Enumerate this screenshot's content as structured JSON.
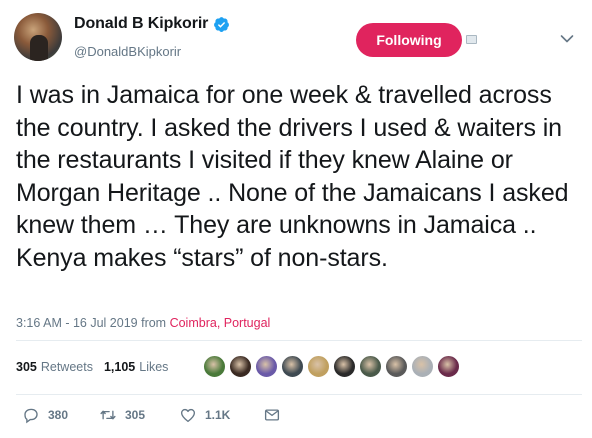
{
  "user": {
    "display_name": "Donald B Kipkorir",
    "handle": "@DonaldBKipkorir"
  },
  "follow_button": {
    "label": "Following",
    "color": "#e0245e"
  },
  "tweet": {
    "text": "I was in Jamaica for one week & travelled across the country. I asked the drivers I used & waiters in the restaurants I visited if they knew Alaine or Morgan Heritage .. None of the Jamaicans I asked knew them … They are unknowns in Jamaica .. Kenya makes “stars” of non-stars.",
    "timestamp": "3:16 AM - 16 Jul 2019",
    "from_label": "from",
    "location": "Coimbra, Portugal"
  },
  "stats": {
    "retweets_count": "305",
    "retweets_label": "Retweets",
    "likes_count": "1,105",
    "likes_label": "Likes"
  },
  "likers": [
    {
      "color": "#4a7a3a"
    },
    {
      "color": "#3a2a22"
    },
    {
      "color": "#6a5aa8"
    },
    {
      "color": "#3f4a52"
    },
    {
      "color": "#c0a060"
    },
    {
      "color": "#2a2a2a"
    },
    {
      "color": "#4a5a4a"
    },
    {
      "color": "#5a5a5a"
    },
    {
      "color": "#aab0b6"
    },
    {
      "color": "#6a2a4a"
    }
  ],
  "actions": {
    "reply_count": "380",
    "retweet_count": "305",
    "like_count": "1.1K"
  },
  "icons": {
    "verified": "verified-badge-icon",
    "caret": "chevron-down-icon",
    "reply": "reply-icon",
    "retweet": "retweet-icon",
    "like": "heart-icon",
    "dm": "envelope-icon"
  },
  "colors": {
    "accent": "#1da1f2",
    "secondary_text": "#657786",
    "location": "#e0245e"
  }
}
